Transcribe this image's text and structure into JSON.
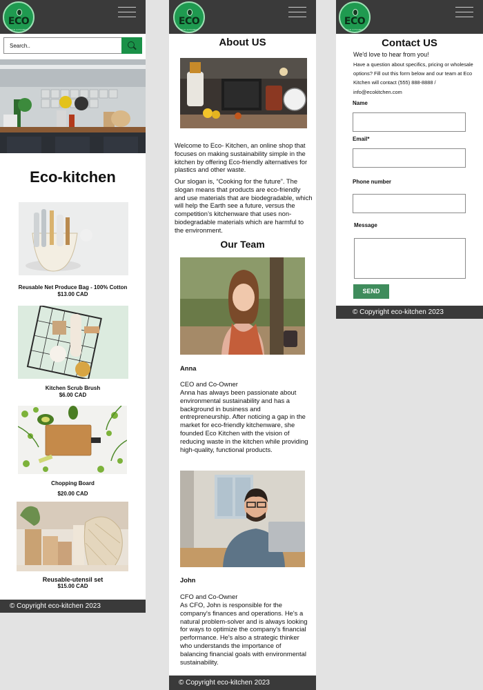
{
  "colors": {
    "navbar": "#3a3a3a",
    "brand_green": "#1f9a50",
    "search_button": "#1a9148",
    "send_button": "#3f8c5c",
    "canvas": "#e3e3e3"
  },
  "brand": {
    "logo_text": "ECO",
    "logo_ring_text": "ECO KITCHEN",
    "menu_icon": "hamburger-icon"
  },
  "shop": {
    "search": {
      "placeholder": "Search..",
      "icon": "search-icon"
    },
    "title": "Eco-kitchen",
    "products": [
      {
        "name": "Reusable Net Produce  Bag - 100% Cotton",
        "price": "$13.00 CAD"
      },
      {
        "name": "Kitchen Scrub Brush",
        "price": "$6.00 CAD"
      },
      {
        "name": "Chopping Board",
        "price": "$20.00 CAD"
      },
      {
        "name": "Reusable-utensil set",
        "price": "$15.00 CAD"
      }
    ],
    "footer": "© Copyright eco-kitchen 2023"
  },
  "about": {
    "title": "About US",
    "paragraph1": "Welcome to Eco- Kitchen, an online shop that focuses on making sustainability simple in the kitchen by offering Eco-friendly alternatives for plastics and other waste.",
    "paragraph2": "Our slogan is, “Cooking for the future”. The slogan means that products are eco-friendly and use materials that are biodegradable, which will help the Earth see a future, versus the competition’s kitchenware that uses non-biodegradable materials which are harmful to the environment.",
    "team_title": "Our Team",
    "team": [
      {
        "name": "Anna",
        "role": "CEO and Co-Owner",
        "bio": "Anna has always been passionate about environmental sustainability and has a background in business and entrepreneurship. After noticing a gap in the market for eco-friendly kitchenware, she founded Eco Kitchen with the vision of reducing waste in the kitchen while providing high-quality, functional products."
      },
      {
        "name": "John",
        "role": "CFO and Co-Owner",
        "bio": "As CFO, John is responsible for the company's finances and operations. He's a natural problem-solver and is always looking for ways to optimize the company's financial performance. He's also a strategic thinker who understands the importance of balancing financial goals with environmental sustainability."
      }
    ],
    "footer": "© Copyright eco-kitchen 2023"
  },
  "contact": {
    "title": "Contact US",
    "intro": "We'd love to hear from you!",
    "description": "Have a question about specifics, pricing or wholesale options? Fill out this form below and our team at Eco Kitchen will contact (555) 888-8888 / info@ecokitchen.com",
    "fields": {
      "name": "Name",
      "email": "Email*",
      "phone": "Phone number",
      "message": "Message"
    },
    "send": "SEND",
    "footer": "© Copyright eco-kitchen 2023"
  }
}
